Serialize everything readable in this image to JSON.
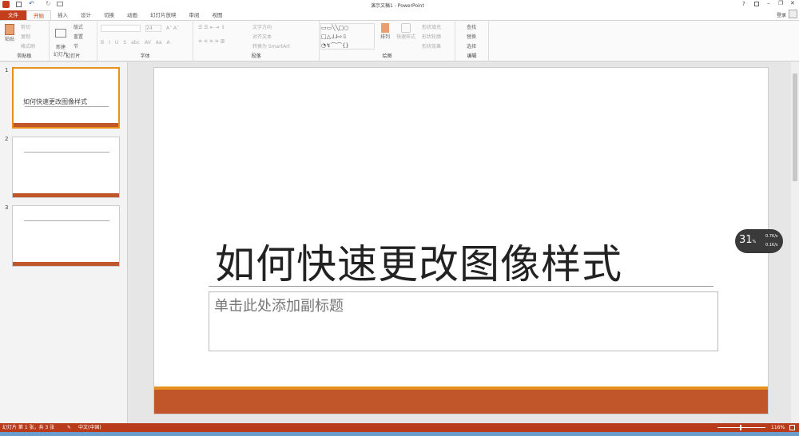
{
  "window": {
    "title": "演示文稿1 - PowerPoint",
    "signin": "登录"
  },
  "tabs": [
    "文件",
    "开始",
    "插入",
    "设计",
    "切换",
    "动画",
    "幻灯片放映",
    "审阅",
    "视图"
  ],
  "ribbon": {
    "clipboard": {
      "label": "剪贴板",
      "paste": "粘贴",
      "cut": "剪切",
      "copy": "复制",
      "format_painter": "格式刷"
    },
    "slides": {
      "label": "幻灯片",
      "new_slide": "新建\n幻灯片",
      "layout": "版式",
      "reset": "重置",
      "section": "节"
    },
    "font": {
      "label": "字体",
      "size": "24",
      "buttons": [
        "B",
        "I",
        "U",
        "S",
        "abc",
        "AV",
        "Aa",
        "A"
      ]
    },
    "paragraph": {
      "label": "段落",
      "text_direction": "文字方向",
      "align_text": "对齐文本",
      "convert_smartart": "转换为 SmartArt"
    },
    "drawing": {
      "label": "绘图",
      "arrange": "排列",
      "quick_styles": "快速样式",
      "shape_fill": "形状填充",
      "shape_outline": "形状轮廓",
      "shape_effects": "形状效果"
    },
    "editing": {
      "label": "编辑",
      "find": "查找",
      "replace": "替换",
      "select": "选择"
    }
  },
  "thumbnails": [
    {
      "number": "1",
      "title": "如何快速更改图像样式"
    },
    {
      "number": "2"
    },
    {
      "number": "3"
    }
  ],
  "slide": {
    "title": "如何快速更改图像样式",
    "subtitle_placeholder": "单击此处添加副标题"
  },
  "net_widget": {
    "percent": "31",
    "unit": "%",
    "up": "0.7K/s",
    "down": "0.1K/s"
  },
  "status": {
    "slide_info": "幻灯片 第 1 张，共 3 张",
    "language": "中文(中国)",
    "zoom": "116%"
  },
  "colors": {
    "accent": "#c43e1c",
    "slide_bar": "#c0562a",
    "slide_bar_top": "#e8901c"
  }
}
